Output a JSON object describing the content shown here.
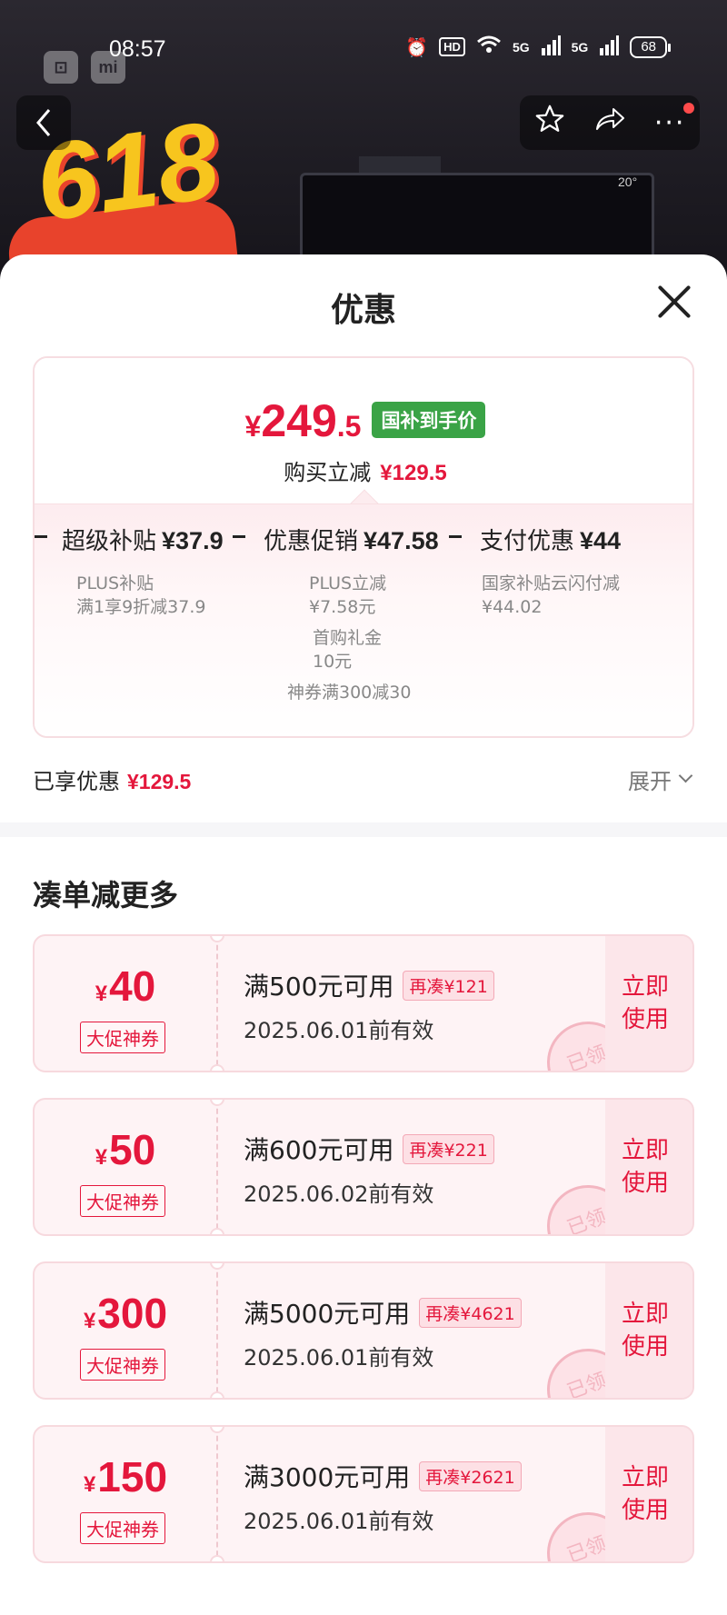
{
  "status_bar": {
    "time": "08:57",
    "hd_label": "HD",
    "net1": "5G",
    "net2": "5G",
    "battery": "68",
    "badge1": "⊡",
    "badge2": "mi"
  },
  "background": {
    "promo_text": "618",
    "product_temp": "20°"
  },
  "sheet": {
    "title": "优惠",
    "price_card": {
      "currency": "¥",
      "price_int": "249",
      "price_dec": ".5",
      "tag": "国补到手价",
      "sub_label": "购买立减",
      "sub_amount": "¥129.5",
      "breakdown": [
        {
          "label": "超级补贴",
          "amount": "¥37.9",
          "items": [
            "PLUS补贴",
            "满1享9折减37.9"
          ]
        },
        {
          "label": "优惠促销",
          "amount": "¥47.58",
          "items": [
            "PLUS立减",
            "¥7.58元",
            "首购礼金",
            "10元",
            "神券满300减30"
          ]
        },
        {
          "label": "支付优惠",
          "amount": "¥44",
          "items": [
            "国家补贴云闪付减",
            "¥44.02"
          ]
        }
      ]
    },
    "enjoyed_label": "已享优惠",
    "enjoyed_amount": "¥129.5",
    "expand_label": "展开",
    "section_title": "凑单减更多",
    "coupons": [
      {
        "currency": "¥",
        "amount": "40",
        "type": "大促神券",
        "condition": "满500元可用",
        "more": "再凑¥121",
        "valid": "2025.06.01前有效",
        "use": "立即使用",
        "stamp": "已领"
      },
      {
        "currency": "¥",
        "amount": "50",
        "type": "大促神券",
        "condition": "满600元可用",
        "more": "再凑¥221",
        "valid": "2025.06.02前有效",
        "use": "立即使用",
        "stamp": "已领"
      },
      {
        "currency": "¥",
        "amount": "300",
        "type": "大促神券",
        "condition": "满5000元可用",
        "more": "再凑¥4621",
        "valid": "2025.06.01前有效",
        "use": "立即使用",
        "stamp": "已领"
      },
      {
        "currency": "¥",
        "amount": "150",
        "type": "大促神券",
        "condition": "满3000元可用",
        "more": "再凑¥2621",
        "valid": "2025.06.01前有效",
        "use": "立即使用",
        "stamp": "已领"
      }
    ]
  },
  "colors": {
    "accent_red": "#e4173c",
    "tag_green": "#3aa346"
  }
}
